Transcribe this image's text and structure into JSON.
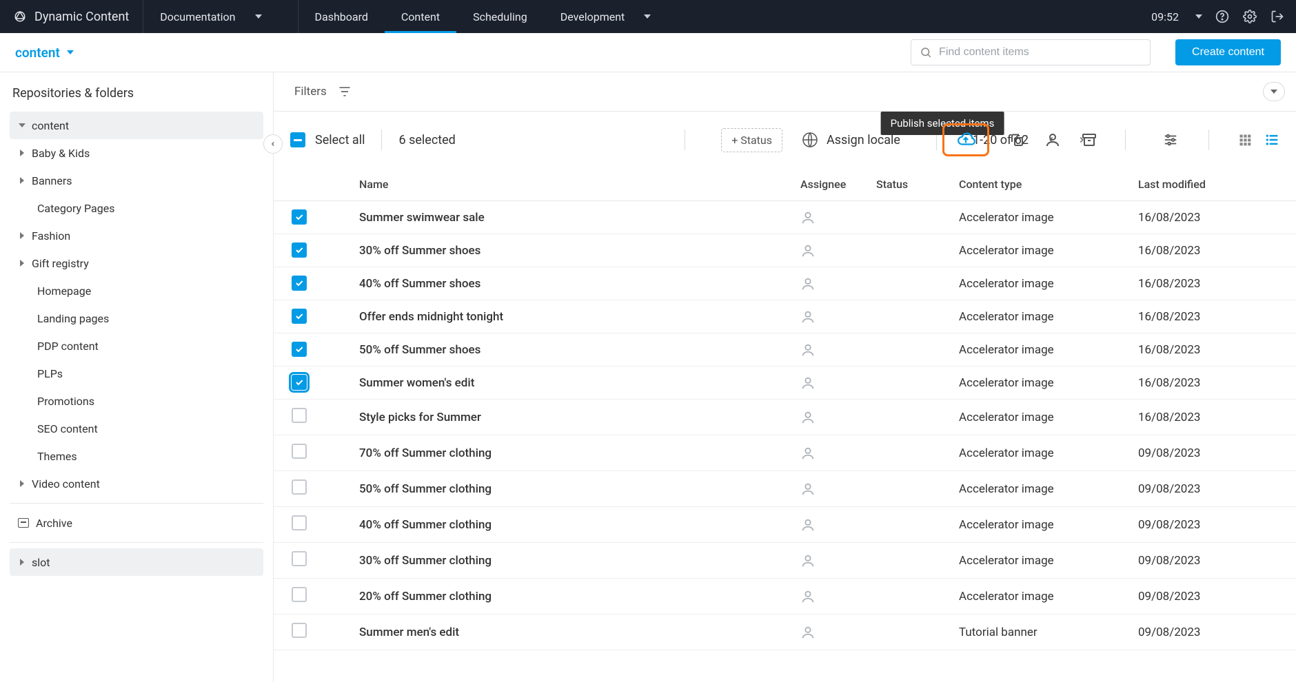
{
  "brand": "Dynamic Content",
  "nav": {
    "documentation": "Documentation",
    "dashboard": "Dashboard",
    "content": "Content",
    "scheduling": "Scheduling",
    "development": "Development"
  },
  "clock": "09:52",
  "repo_selector": "content",
  "search_placeholder": "Find content items",
  "create_button": "Create content",
  "sidebar": {
    "title": "Repositories & folders",
    "items": [
      {
        "label": "content",
        "level": 0,
        "expandable": true,
        "expanded": true,
        "selected": true
      },
      {
        "label": "Baby & Kids",
        "level": 1,
        "expandable": true
      },
      {
        "label": "Banners",
        "level": 1,
        "expandable": true
      },
      {
        "label": "Category Pages",
        "level": 2
      },
      {
        "label": "Fashion",
        "level": 1,
        "expandable": true
      },
      {
        "label": "Gift registry",
        "level": 1,
        "expandable": true
      },
      {
        "label": "Homepage",
        "level": 2
      },
      {
        "label": "Landing pages",
        "level": 2
      },
      {
        "label": "PDP content",
        "level": 2
      },
      {
        "label": "PLPs",
        "level": 2
      },
      {
        "label": "Promotions",
        "level": 2
      },
      {
        "label": "SEO content",
        "level": 2
      },
      {
        "label": "Themes",
        "level": 2
      },
      {
        "label": "Video content",
        "level": 1,
        "expandable": true
      }
    ],
    "archive": "Archive",
    "slot": "slot"
  },
  "filters_label": "Filters",
  "toolbar": {
    "select_all": "Select all",
    "selected_count": "6 selected",
    "tooltip": "Publish selected items",
    "add_status": "+ Status",
    "assign_locale": "Assign locale",
    "pager": "1-20 of 62"
  },
  "columns": {
    "name": "Name",
    "assignee": "Assignee",
    "status": "Status",
    "content_type": "Content type",
    "last_modified": "Last modified"
  },
  "rows": [
    {
      "selected": true,
      "name": "Summer swimwear sale",
      "type": "Accelerator image",
      "modified": "16/08/2023"
    },
    {
      "selected": true,
      "name": "30% off Summer shoes",
      "type": "Accelerator image",
      "modified": "16/08/2023"
    },
    {
      "selected": true,
      "name": "40% off Summer shoes",
      "type": "Accelerator image",
      "modified": "16/08/2023"
    },
    {
      "selected": true,
      "name": "Offer ends midnight tonight",
      "type": "Accelerator image",
      "modified": "16/08/2023"
    },
    {
      "selected": true,
      "name": "50% off Summer shoes",
      "type": "Accelerator image",
      "modified": "16/08/2023"
    },
    {
      "selected": true,
      "focused": true,
      "name": "Summer women's edit",
      "type": "Accelerator image",
      "modified": "16/08/2023"
    },
    {
      "selected": false,
      "name": "Style picks for Summer",
      "type": "Accelerator image",
      "modified": "16/08/2023"
    },
    {
      "selected": false,
      "name": "70% off Summer clothing",
      "type": "Accelerator image",
      "modified": "09/08/2023"
    },
    {
      "selected": false,
      "name": "50% off Summer clothing",
      "type": "Accelerator image",
      "modified": "09/08/2023"
    },
    {
      "selected": false,
      "name": "40% off Summer clothing",
      "type": "Accelerator image",
      "modified": "09/08/2023"
    },
    {
      "selected": false,
      "name": "30% off Summer clothing",
      "type": "Accelerator image",
      "modified": "09/08/2023"
    },
    {
      "selected": false,
      "name": "20% off Summer clothing",
      "type": "Accelerator image",
      "modified": "09/08/2023"
    },
    {
      "selected": false,
      "name": "Summer men's edit",
      "type": "Tutorial banner",
      "modified": "09/08/2023"
    }
  ]
}
